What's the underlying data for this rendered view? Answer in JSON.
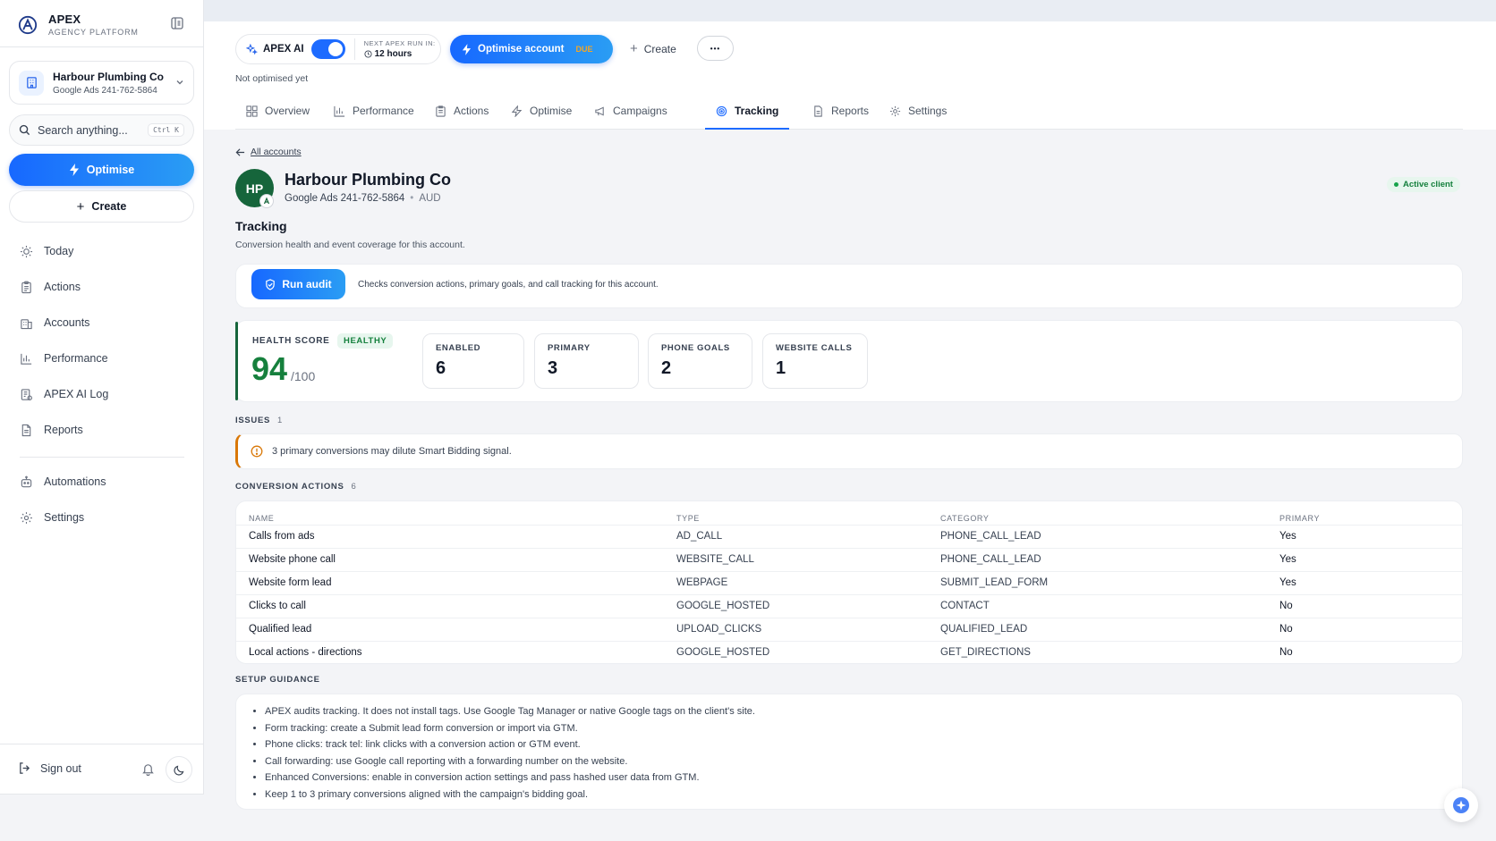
{
  "brand": {
    "title": "APEX",
    "subtitle": "AGENCY PLATFORM"
  },
  "sidebar": {
    "account": {
      "name": "Harbour Plumbing Co",
      "id": "Google Ads 241-762-5864"
    },
    "search": {
      "placeholder": "Search anything...",
      "shortcut": "Ctrl K"
    },
    "optimise_label": "Optimise",
    "create_label": "Create",
    "nav": [
      {
        "label": "Today",
        "icon": "sun-icon"
      },
      {
        "label": "Actions",
        "icon": "clipboard-icon"
      },
      {
        "label": "Accounts",
        "icon": "building-icon"
      },
      {
        "label": "Performance",
        "icon": "bar-chart-icon"
      },
      {
        "label": "APEX AI Log",
        "icon": "log-icon"
      },
      {
        "label": "Reports",
        "icon": "document-icon"
      },
      {
        "label": "Automations",
        "icon": "robot-icon"
      },
      {
        "label": "Settings",
        "icon": "gear-icon"
      }
    ],
    "signout_label": "Sign out"
  },
  "topbar": {
    "ai_label": "APEX AI",
    "ai_enabled": true,
    "next_run_label": "NEXT APEX RUN IN:",
    "next_run_value": "12 hours",
    "optimise_account_label": "Optimise account",
    "optimise_badge": "DUE",
    "create_label": "Create",
    "more_label": "•••",
    "status_text": "Not optimised yet"
  },
  "tabs": [
    {
      "label": "Overview",
      "icon": "grid-icon",
      "active": false
    },
    {
      "label": "Performance",
      "icon": "bar-chart-icon",
      "active": false
    },
    {
      "label": "Actions",
      "icon": "clipboard-icon",
      "active": false
    },
    {
      "label": "Optimise",
      "icon": "lightning-icon",
      "active": false
    },
    {
      "label": "Campaigns",
      "icon": "megaphone-icon",
      "active": false
    },
    {
      "label": "Tracking",
      "icon": "target-icon",
      "active": true
    },
    {
      "label": "Reports",
      "icon": "document-icon",
      "active": false
    },
    {
      "label": "Settings",
      "icon": "gear-icon",
      "active": false
    }
  ],
  "header": {
    "back_label": "All accounts",
    "initials": "HP",
    "name": "Harbour Plumbing Co",
    "account_id": "Google Ads 241-762-5864",
    "currency": "AUD",
    "status_badge": "Active client"
  },
  "tracking": {
    "title": "Tracking",
    "subtitle": "Conversion health and event coverage for this account.",
    "audit_button": "Run audit",
    "audit_desc": "Checks conversion actions, primary goals, and call tracking for this account."
  },
  "health": {
    "label": "HEALTH SCORE",
    "badge": "HEALTHY",
    "score": "94",
    "max": "/100",
    "stats": [
      {
        "label": "ENABLED",
        "value": "6"
      },
      {
        "label": "PRIMARY",
        "value": "3"
      },
      {
        "label": "PHONE GOALS",
        "value": "2"
      },
      {
        "label": "WEBSITE CALLS",
        "value": "1"
      }
    ]
  },
  "issues": {
    "label": "ISSUES",
    "count": "1",
    "items": [
      "3 primary conversions may dilute Smart Bidding signal."
    ]
  },
  "conversion_actions": {
    "label": "CONVERSION ACTIONS",
    "count": "6",
    "columns": [
      "NAME",
      "TYPE",
      "CATEGORY",
      "PRIMARY"
    ],
    "rows": [
      [
        "Calls from ads",
        "AD_CALL",
        "PHONE_CALL_LEAD",
        "Yes"
      ],
      [
        "Website phone call",
        "WEBSITE_CALL",
        "PHONE_CALL_LEAD",
        "Yes"
      ],
      [
        "Website form lead",
        "WEBPAGE",
        "SUBMIT_LEAD_FORM",
        "Yes"
      ],
      [
        "Clicks to call",
        "GOOGLE_HOSTED",
        "CONTACT",
        "No"
      ],
      [
        "Qualified lead",
        "UPLOAD_CLICKS",
        "QUALIFIED_LEAD",
        "No"
      ],
      [
        "Local actions - directions",
        "GOOGLE_HOSTED",
        "GET_DIRECTIONS",
        "No"
      ]
    ]
  },
  "guidance": {
    "label": "SETUP GUIDANCE",
    "items": [
      "APEX audits tracking. It does not install tags. Use Google Tag Manager or native Google tags on the client's site.",
      "Form tracking: create a Submit lead form conversion or import via GTM.",
      "Phone clicks: track tel: link clicks with a conversion action or GTM event.",
      "Call forwarding: use Google call reporting with a forwarding number on the website.",
      "Enhanced Conversions: enable in conversion action settings and pass hashed user data from GTM.",
      "Keep 1 to 3 primary conversions aligned with the campaign's bidding goal."
    ]
  },
  "colors": {
    "accent": "#1d6bff",
    "success": "#16803d",
    "warning": "#d97706",
    "avatar": "#16653b"
  }
}
